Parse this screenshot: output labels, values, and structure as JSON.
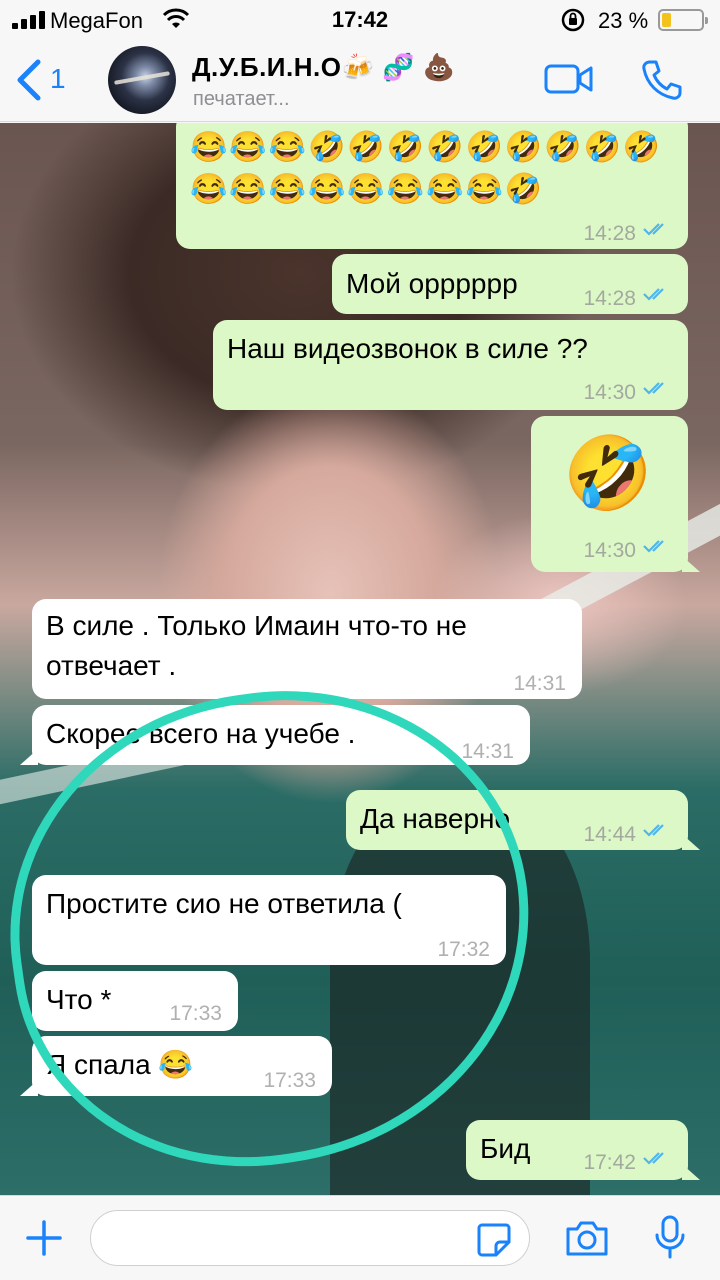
{
  "status_bar": {
    "carrier": "MegaFon",
    "time": "17:42",
    "battery_percent": "23 %",
    "battery_level": 0.23
  },
  "header": {
    "back_count": "1",
    "contact_name": "Д.У.Б.И.Н.О🍻 🧬 💩",
    "contact_status": "печатает..."
  },
  "messages": [
    {
      "direction": "out",
      "emoji_line_1": "😂😂😂🤣🤣🤣🤣🤣🤣🤣🤣🤣",
      "emoji_line_2": "😂😂😂😂😂😂😂😂🤣",
      "time": "14:28"
    },
    {
      "direction": "out",
      "text": "Мой орррррр",
      "time": "14:28"
    },
    {
      "direction": "out",
      "text": "Наш видеозвонок в силе ??",
      "time": "14:30"
    },
    {
      "direction": "out",
      "text": "🤣",
      "time": "14:30"
    },
    {
      "direction": "in",
      "text_line_1": "В силе . Только Имаин что-то не",
      "text_line_2": "отвечает .",
      "time": "14:31"
    },
    {
      "direction": "in",
      "text": "Скорее всего на учебе .",
      "time": "14:31"
    },
    {
      "direction": "out",
      "text": "Да наверно",
      "time": "14:44"
    },
    {
      "direction": "in",
      "text": "Простите сио не ответила (",
      "time": "17:32"
    },
    {
      "direction": "in",
      "text": "Что *",
      "time": "17:33"
    },
    {
      "direction": "in",
      "text": "Я спала 😂",
      "time": "17:33"
    },
    {
      "direction": "out",
      "text": "Бид",
      "time": "17:42"
    }
  ],
  "colors": {
    "accent": "#1a82fb",
    "outgoing_bubble": "#dcf8c6",
    "incoming_bubble": "#ffffff",
    "read_ticks": "#4fb6ec",
    "annotation_circle": "#2fd7bb"
  }
}
